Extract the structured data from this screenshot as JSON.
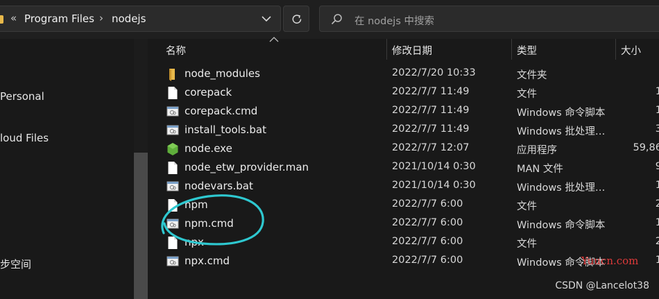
{
  "breadcrumb": {
    "overflow": "«",
    "items": [
      "Program Files",
      "nodejs"
    ],
    "separator": "›"
  },
  "search": {
    "placeholder": "在 nodejs 中搜索"
  },
  "nav": {
    "items": [
      "Personal",
      "loud Files",
      "步空间"
    ]
  },
  "columns": {
    "name": "名称",
    "date": "修改日期",
    "type": "类型",
    "size": "大小"
  },
  "files": [
    {
      "name": "node_modules",
      "date": "2022/7/20 10:33",
      "type": "文件夹",
      "size": "",
      "icon": "folder-icon"
    },
    {
      "name": "corepack",
      "date": "2022/7/7 11:49",
      "type": "文件",
      "size": "1",
      "icon": "file-icon"
    },
    {
      "name": "corepack.cmd",
      "date": "2022/7/7 11:49",
      "type": "Windows 命令脚本",
      "size": "1",
      "icon": "script-icon"
    },
    {
      "name": "install_tools.bat",
      "date": "2022/7/7 11:49",
      "type": "Windows 批处理…",
      "size": "3",
      "icon": "script-icon"
    },
    {
      "name": "node.exe",
      "date": "2022/7/7 12:07",
      "type": "应用程序",
      "size": "59,86",
      "icon": "node-icon"
    },
    {
      "name": "node_etw_provider.man",
      "date": "2021/10/14 0:30",
      "type": "MAN 文件",
      "size": "9",
      "icon": "file-icon"
    },
    {
      "name": "nodevars.bat",
      "date": "2021/10/14 0:30",
      "type": "Windows 批处理…",
      "size": "1",
      "icon": "script-icon"
    },
    {
      "name": "npm",
      "date": "2022/7/7 6:00",
      "type": "文件",
      "size": "2",
      "icon": "file-icon"
    },
    {
      "name": "npm.cmd",
      "date": "2022/7/7 6:00",
      "type": "Windows 命令脚本",
      "size": "1",
      "icon": "script-icon"
    },
    {
      "name": "npx",
      "date": "2022/7/7 6:00",
      "type": "文件",
      "size": "2",
      "icon": "file-icon"
    },
    {
      "name": "npx.cmd",
      "date": "2022/7/7 6:00",
      "type": "Windows 命令脚本",
      "size": "1",
      "icon": "script-icon"
    }
  ],
  "watermarks": {
    "red": "Yuucn.com",
    "csdn": "CSDN @Lancelot38"
  },
  "colors": {
    "annotation": "#2ec8d0",
    "folder": "#e8b84a",
    "node": "#5fae3b"
  }
}
